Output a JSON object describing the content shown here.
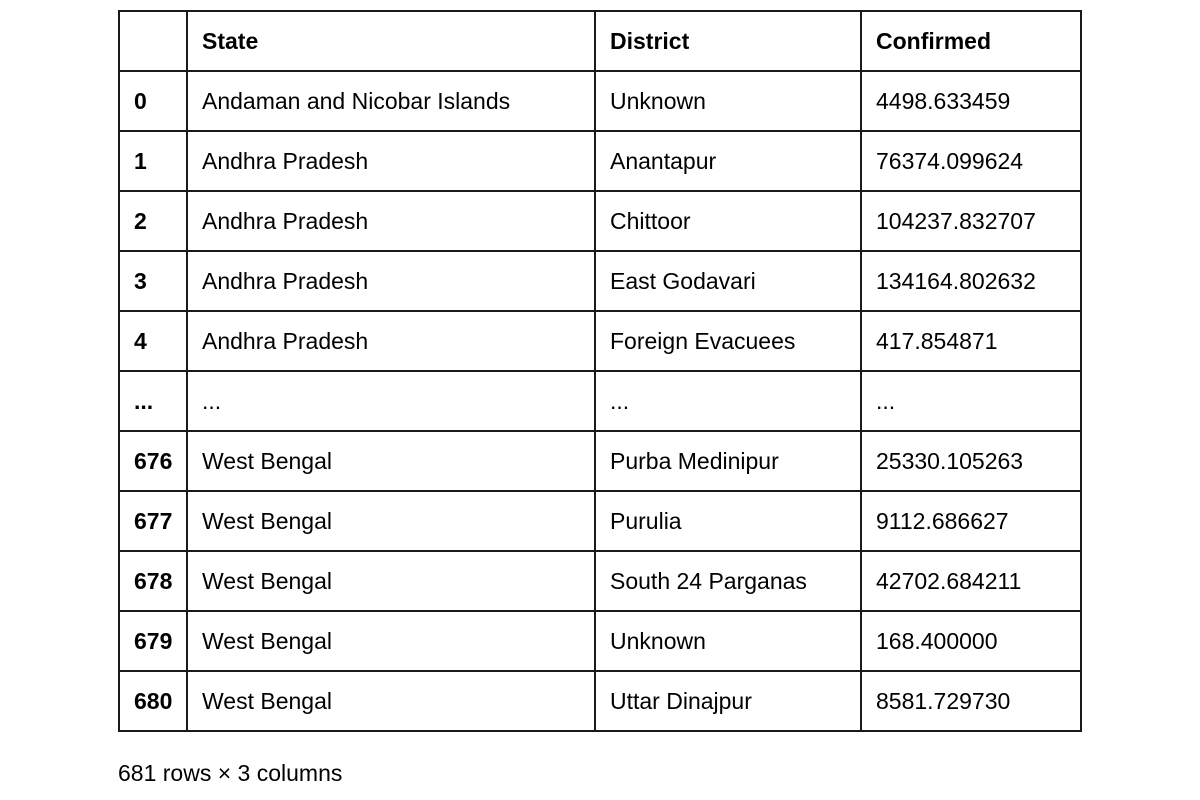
{
  "dataframe": {
    "columns": [
      "",
      "State",
      "District",
      "Confirmed"
    ],
    "index_header": "",
    "rows": [
      {
        "index": "0",
        "state": "Andaman and Nicobar Islands",
        "district": "Unknown",
        "confirmed": "4498.633459"
      },
      {
        "index": "1",
        "state": "Andhra Pradesh",
        "district": "Anantapur",
        "confirmed": "76374.099624"
      },
      {
        "index": "2",
        "state": "Andhra Pradesh",
        "district": "Chittoor",
        "confirmed": "104237.832707"
      },
      {
        "index": "3",
        "state": "Andhra Pradesh",
        "district": "East Godavari",
        "confirmed": "134164.802632"
      },
      {
        "index": "4",
        "state": "Andhra Pradesh",
        "district": "Foreign Evacuees",
        "confirmed": "417.854871"
      },
      {
        "index": "...",
        "state": "...",
        "district": "...",
        "confirmed": "..."
      },
      {
        "index": "676",
        "state": "West Bengal",
        "district": "Purba Medinipur",
        "confirmed": "25330.105263"
      },
      {
        "index": "677",
        "state": "West Bengal",
        "district": "Purulia",
        "confirmed": "9112.686627"
      },
      {
        "index": "678",
        "state": "West Bengal",
        "district": "South 24 Parganas",
        "confirmed": "42702.684211"
      },
      {
        "index": "679",
        "state": "West Bengal",
        "district": "Unknown",
        "confirmed": "168.400000"
      },
      {
        "index": "680",
        "state": "West Bengal",
        "district": "Uttar Dinajpur",
        "confirmed": "8581.729730"
      }
    ],
    "shape_caption": "681 rows × 3 columns"
  }
}
